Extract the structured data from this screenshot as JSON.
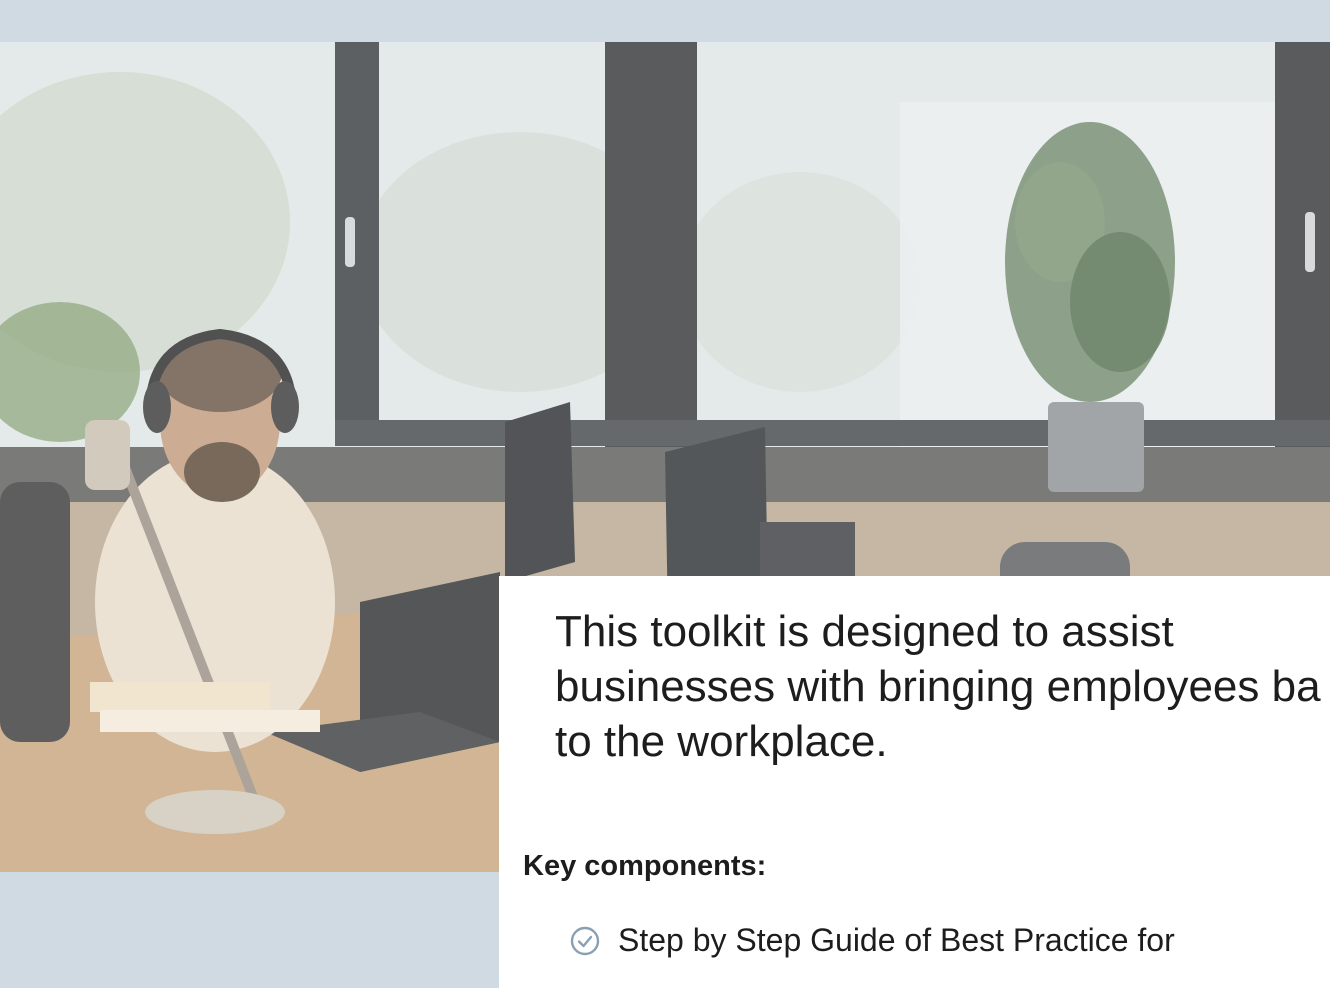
{
  "hero": {
    "image": "office-worker-with-headphones-photo"
  },
  "content": {
    "intro_lines": [
      "This toolkit is designed to assist",
      "businesses with bringing employees ba",
      "to the workplace."
    ],
    "key_heading": "Key components:",
    "bullets": [
      {
        "icon": "check-circle-icon",
        "label": "Step by Step Guide of Best Practice for"
      }
    ]
  },
  "colors": {
    "page_background": "#cfdae3",
    "card_background": "#ffffff",
    "text": "#1d1d1d",
    "check_icon": "#8aa0b2"
  }
}
